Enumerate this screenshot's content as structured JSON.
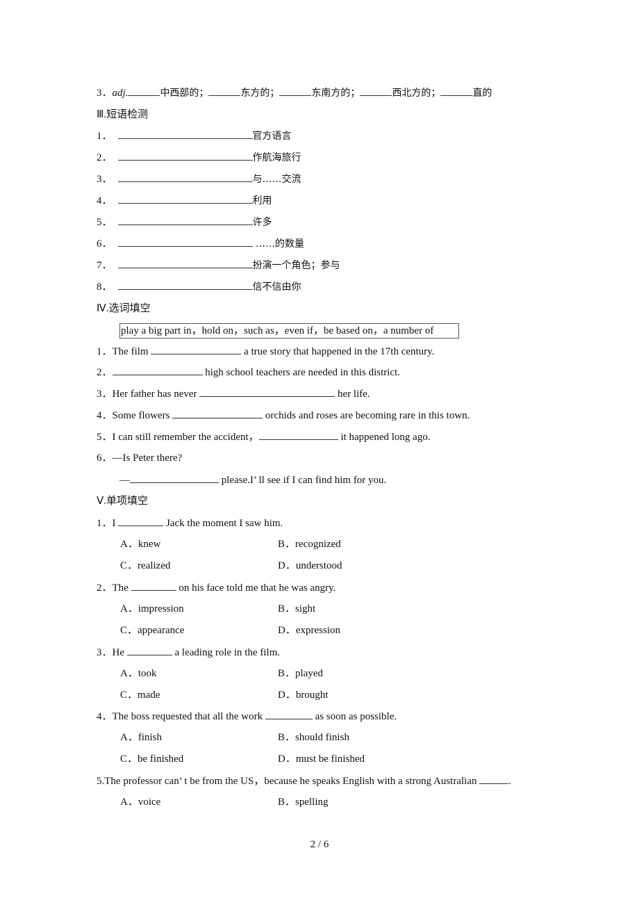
{
  "section2_tail": {
    "number": "3．",
    "pos": "adj.",
    "items": [
      "中西部的；",
      "东方的；",
      "东南方的；",
      "西北方的；",
      "直的"
    ]
  },
  "section3": {
    "heading_roman": "Ⅲ.",
    "heading_text": "短语检测",
    "items": [
      {
        "num": "1．",
        "hint": "官方语言"
      },
      {
        "num": "2．",
        "hint": "作航海旅行"
      },
      {
        "num": "3．",
        "hint": "与……交流"
      },
      {
        "num": "4．",
        "hint": "利用"
      },
      {
        "num": "5．",
        "hint": "许多"
      },
      {
        "num": "6．",
        "hint": " ……的数量"
      },
      {
        "num": "7．",
        "hint": "扮演一个角色；参与"
      },
      {
        "num": "8．",
        "hint": "信不信由你"
      }
    ]
  },
  "section4": {
    "heading_roman": "Ⅳ.",
    "heading_text": "选词填空",
    "word_bank": "play a big part in，hold on，such as，even if，be based on，a number of",
    "items": [
      {
        "num": "1．",
        "before": "The film ",
        "after": " a true story that happened in the 17th century."
      },
      {
        "num": "2．",
        "before": "",
        "after": " high school teachers are needed in this district."
      },
      {
        "num": "3．",
        "before": "Her father has never ",
        "after": " her life."
      },
      {
        "num": "4．",
        "before": "Some flowers ",
        "after": " orchids and roses are becoming rare in this town."
      },
      {
        "num": "5．",
        "before": "I can still remember the accident，",
        "after": " it happened long ago."
      },
      {
        "num": "6．",
        "before": "—Is Peter there?",
        "after": ""
      }
    ],
    "item6_reply_prefix": "—",
    "item6_reply_after": " please.I’ ll see if I can find him for you."
  },
  "section5": {
    "heading_roman": "Ⅴ.",
    "heading_text": "单项填空",
    "questions": [
      {
        "num": "1．",
        "before": "I ",
        "after": " Jack the moment I saw him.",
        "options": [
          {
            "letter": "A．",
            "text": "knew"
          },
          {
            "letter": "B．",
            "text": "recognized"
          },
          {
            "letter": "C．",
            "text": "realized"
          },
          {
            "letter": "D．",
            "text": "understood"
          }
        ]
      },
      {
        "num": "2．",
        "before": "The ",
        "after": " on his face told me that he was angry.",
        "options": [
          {
            "letter": "A．",
            "text": "impression"
          },
          {
            "letter": "B．",
            "text": "sight"
          },
          {
            "letter": "C．",
            "text": "appearance"
          },
          {
            "letter": "D．",
            "text": "expression"
          }
        ]
      },
      {
        "num": "3．",
        "before": "He ",
        "after": " a leading role in the film.",
        "options": [
          {
            "letter": "A．",
            "text": "took"
          },
          {
            "letter": "B．",
            "text": "played"
          },
          {
            "letter": "C．",
            "text": "made"
          },
          {
            "letter": "D．",
            "text": "brought"
          }
        ]
      },
      {
        "num": "4．",
        "before": "The boss requested that all the work ",
        "after": " as soon as possible.",
        "options": [
          {
            "letter": "A．",
            "text": "finish"
          },
          {
            "letter": "B．",
            "text": "should finish"
          },
          {
            "letter": "C．",
            "text": "be finished"
          },
          {
            "letter": "D．",
            "text": "must be finished"
          }
        ]
      },
      {
        "num": "5.",
        "before": "The professor can’ t be from the US，because he speaks English with a strong Australian ",
        "after": ".",
        "options": [
          {
            "letter": "A．",
            "text": "voice"
          },
          {
            "letter": "B．",
            "text": "spelling"
          }
        ]
      }
    ]
  },
  "footer": {
    "page_indicator": "2 / 6"
  }
}
